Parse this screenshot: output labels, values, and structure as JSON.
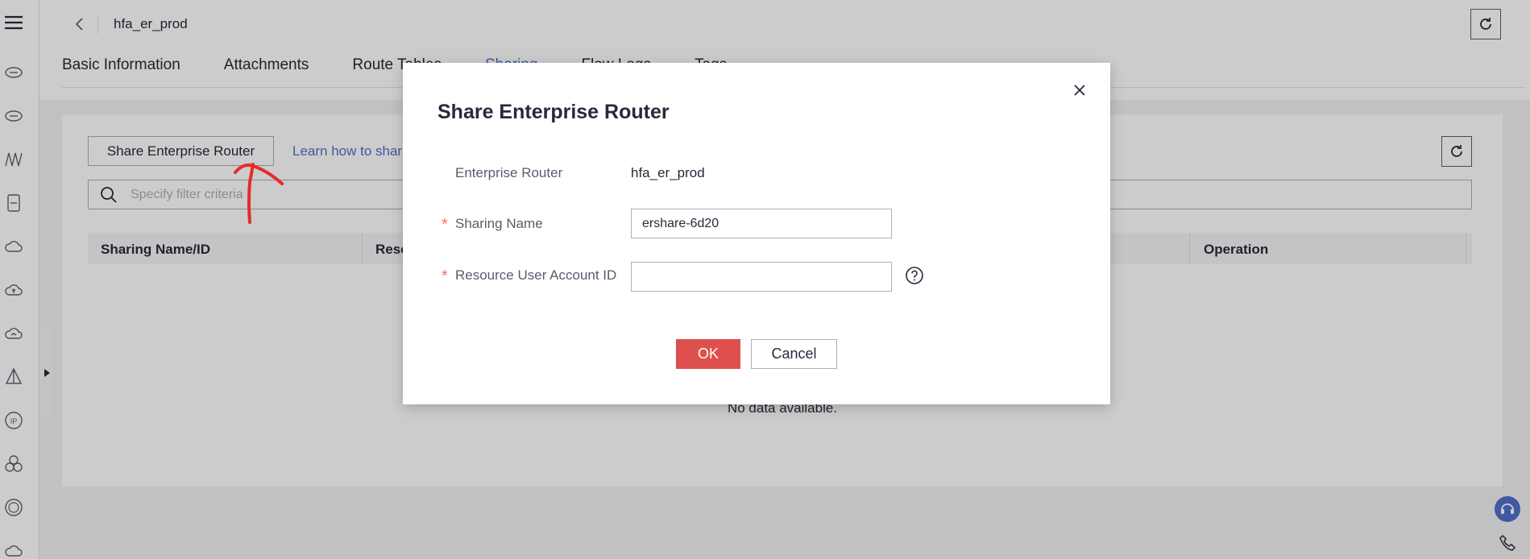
{
  "header": {
    "title": "hfa_er_prod",
    "back_icon": "chevron-left-icon",
    "refresh_icon": "refresh-icon"
  },
  "tabs": [
    {
      "label": "Basic Information"
    },
    {
      "label": "Attachments"
    },
    {
      "label": "Route Tables"
    },
    {
      "label": "Sharing"
    },
    {
      "label": "Flow Logs"
    },
    {
      "label": "Tags"
    }
  ],
  "sidebar": {
    "icons": [
      "menu-icon",
      "router-icon",
      "router-icon",
      "network-icon",
      "storage-icon",
      "cloud-icon",
      "cloud-upload-icon",
      "cloud-sync-icon",
      "triangle-icon",
      "ip-icon",
      "cluster-icon",
      "dns-icon",
      "cloud-icon"
    ]
  },
  "toolbar": {
    "share_button": "Share Enterprise Router",
    "learn_link": "Learn how to share"
  },
  "filter": {
    "placeholder": "Specify filter criteria"
  },
  "table": {
    "columns": [
      "Sharing Name/ID",
      "Reso",
      "Operation"
    ],
    "empty_text": "No data available."
  },
  "modal": {
    "title": "Share Enterprise Router",
    "enterprise_router_label": "Enterprise Router",
    "enterprise_router_value": "hfa_er_prod",
    "sharing_name_label": "Sharing Name",
    "sharing_name_value": "ershare-6d20",
    "account_id_label": "Resource User Account ID",
    "account_id_value": "",
    "required_mark": "*",
    "ok_label": "OK",
    "cancel_label": "Cancel"
  },
  "colors": {
    "accent": "#526ecc",
    "danger": "#de504e",
    "annotation": "#e32b2b"
  }
}
